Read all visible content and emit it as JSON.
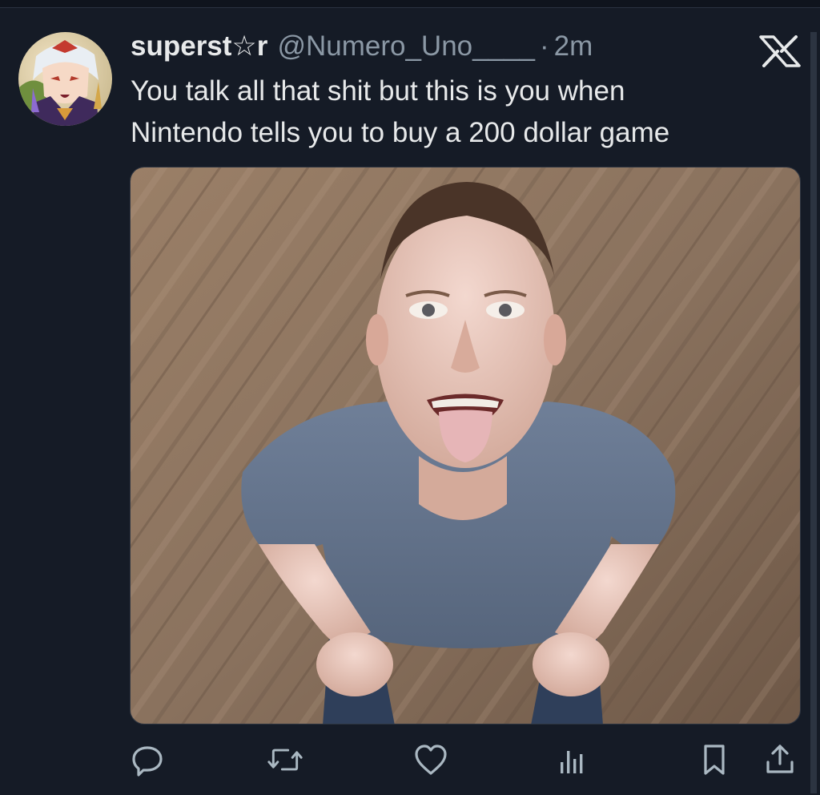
{
  "tweet": {
    "display_name": "superst☆r",
    "handle": "@Numero_Uno____",
    "separator": "·",
    "time": "2m",
    "text_lines": [
      "You talk all that shit but this is you when",
      "Nintendo tells you to buy a 200 dollar game"
    ]
  },
  "icons": {
    "platform_logo": "x-logo-icon",
    "reply": "reply-icon",
    "repost": "repost-icon",
    "like": "heart-icon",
    "views": "views-icon",
    "bookmark": "bookmark-icon",
    "share": "share-icon"
  },
  "colors": {
    "background": "#151b26",
    "text_primary": "#e7e9ea",
    "text_secondary": "#8b98a5",
    "icon": "#aab8c2"
  }
}
